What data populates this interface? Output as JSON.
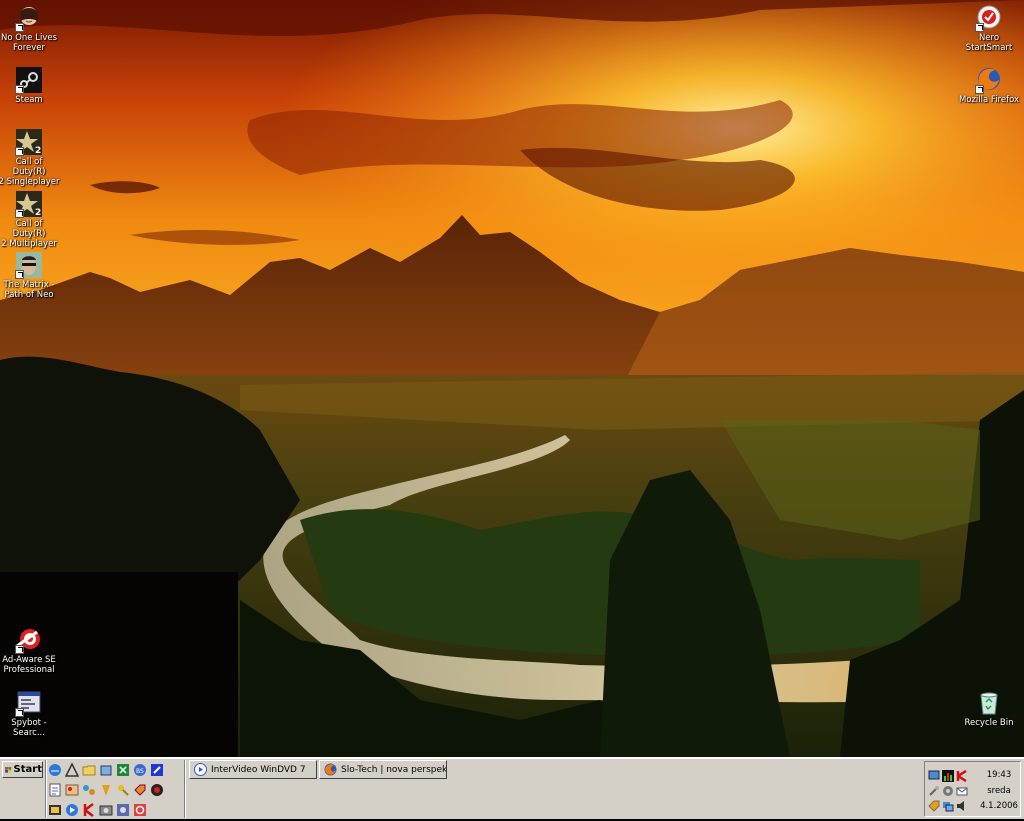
{
  "desktop": {
    "icons_left": [
      {
        "label": "No One Lives\nForever",
        "icon": "nolf-icon"
      },
      {
        "label": "Steam",
        "icon": "steam-icon"
      },
      {
        "label": "Call of Duty(R)\n2 Singleplayer",
        "icon": "cod2-icon"
      },
      {
        "label": "Call of Duty(R)\n2 Multiplayer",
        "icon": "cod2-icon"
      },
      {
        "label": "The Matrix -\nPath of Neo",
        "icon": "matrix-icon"
      },
      {
        "label": "Ad-Aware SE\nProfessional",
        "icon": "adaware-icon"
      },
      {
        "label": "Spybot -\nSearc...",
        "icon": "spybot-icon"
      }
    ],
    "icons_right": [
      {
        "label": "Nero\nStartSmart",
        "icon": "nero-icon"
      },
      {
        "label": "Mozilla Firefox",
        "icon": "firefox-icon"
      },
      {
        "label": "Recycle Bin",
        "icon": "recycle-bin-icon"
      }
    ]
  },
  "taskbar": {
    "start_label": "Start",
    "quick_launch_icons": [
      "ie-icon",
      "acrobat-icon",
      "folder-icon",
      "tool-icon",
      "excel-icon",
      "bs-icon",
      "dvd-icon",
      "notepad-icon",
      "paint-icon",
      "network-icon",
      "winamp-icon",
      "key-icon",
      "tag-icon",
      "dot-icon",
      "sc-icon",
      "play-icon",
      "kaspersky-icon",
      "photo-icon",
      "disc-icon",
      "circle-icon"
    ],
    "tasks": [
      {
        "label": "InterVideo WinDVD 7",
        "icon": "windvd-icon"
      },
      {
        "label": "Slo-Tech | nova perspekt...",
        "icon": "firefox-icon"
      }
    ],
    "tray": {
      "time": "19:43",
      "day": "sreda",
      "date": "4.1.2006"
    }
  },
  "colors": {
    "taskbar_bg": "#d4d0c8",
    "sky_orange": "#f08a10",
    "sky_gold": "#ffc830"
  }
}
